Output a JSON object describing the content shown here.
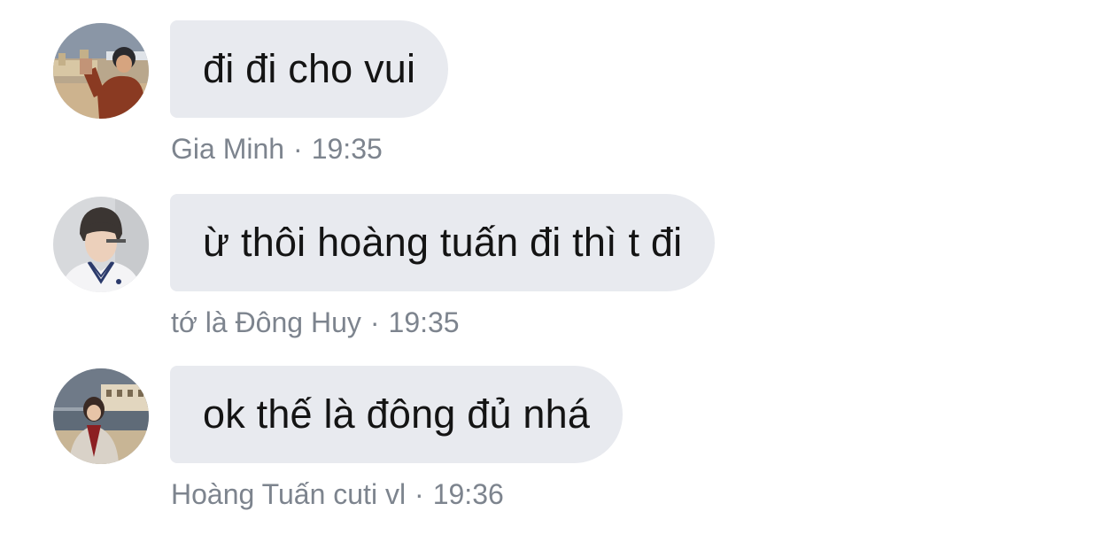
{
  "messages": [
    {
      "text": "đi đi cho vui",
      "sender": "Gia Minh",
      "separator": "·",
      "time": "19:35",
      "avatar_icon": "user-avatar-photo"
    },
    {
      "text": "ừ thôi hoàng tuấn đi thì t đi",
      "sender": "tớ là Đông Huy",
      "separator": "·",
      "time": "19:35",
      "avatar_icon": "user-avatar-photo"
    },
    {
      "text": "ok thế là đông đủ nhá",
      "sender": "Hoàng Tuấn cuti vl",
      "separator": "·",
      "time": "19:36",
      "avatar_icon": "user-avatar-photo"
    }
  ],
  "colors": {
    "bubble_bg": "#e8eaef",
    "message_text": "#141414",
    "meta_text": "#7d848e",
    "background": "#ffffff"
  }
}
